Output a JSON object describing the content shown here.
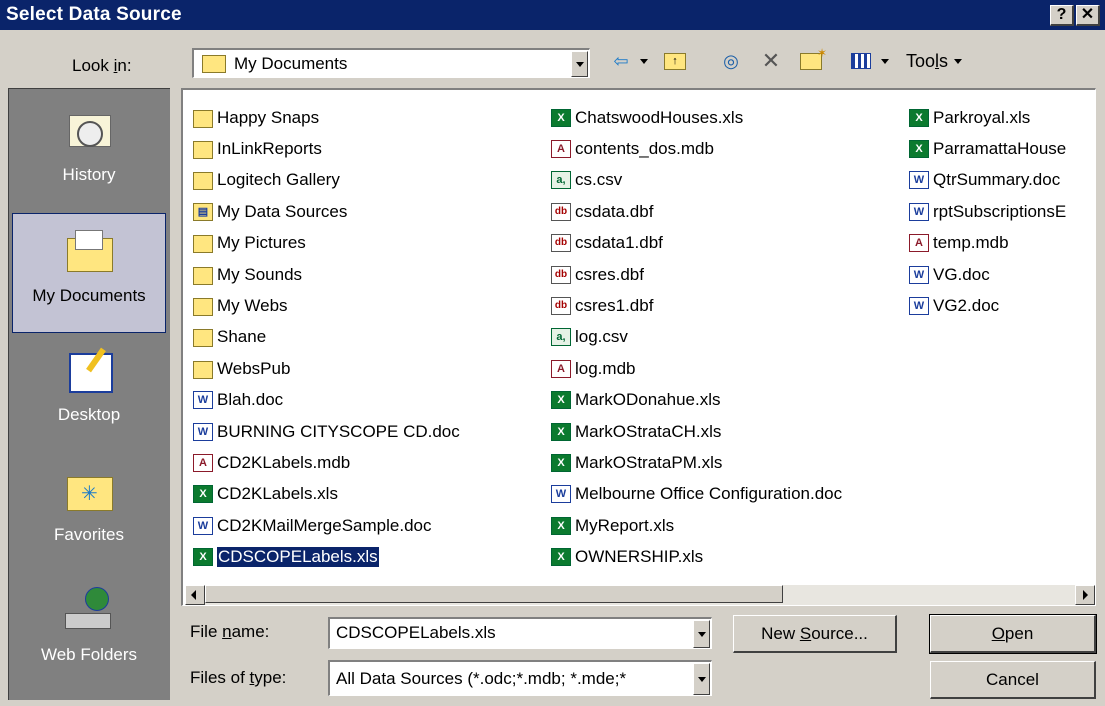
{
  "window": {
    "title": "Select Data Source",
    "help_button": "?",
    "close_button": "✕"
  },
  "toolbar": {
    "look_in_label": "Look in:",
    "look_in_value": "My Documents",
    "tools_label": "Tools",
    "icons": [
      "back-arrow-icon",
      "up-folder-icon",
      "search-web-icon",
      "delete-icon",
      "new-folder-icon",
      "views-icon"
    ]
  },
  "places": [
    {
      "label": "History",
      "icon": "history-icon",
      "selected": false
    },
    {
      "label": "My Documents",
      "icon": "my-documents-icon",
      "selected": true
    },
    {
      "label": "Desktop",
      "icon": "desktop-icon",
      "selected": false
    },
    {
      "label": "Favorites",
      "icon": "favorites-icon",
      "selected": false
    },
    {
      "label": "Web Folders",
      "icon": "web-folders-icon",
      "selected": false
    }
  ],
  "files": {
    "col1": [
      {
        "name": "Happy Snaps",
        "type": "folder"
      },
      {
        "name": "InLinkReports",
        "type": "folder"
      },
      {
        "name": "Logitech Gallery",
        "type": "folder"
      },
      {
        "name": "My Data Sources",
        "type": "ds"
      },
      {
        "name": "My Pictures",
        "type": "folder"
      },
      {
        "name": "My Sounds",
        "type": "folder"
      },
      {
        "name": "My Webs",
        "type": "folder"
      },
      {
        "name": "Shane",
        "type": "folder"
      },
      {
        "name": "WebsPub",
        "type": "folder"
      },
      {
        "name": "Blah.doc",
        "type": "doc"
      },
      {
        "name": "BURNING CITYSCOPE CD.doc",
        "type": "doc"
      },
      {
        "name": "CD2KLabels.mdb",
        "type": "mdb"
      },
      {
        "name": "CD2KLabels.xls",
        "type": "xls"
      },
      {
        "name": "CD2KMailMergeSample.doc",
        "type": "doc"
      },
      {
        "name": "CDSCOPELabels.xls",
        "type": "xls",
        "selected": true
      }
    ],
    "col2": [
      {
        "name": "ChatswoodHouses.xls",
        "type": "xls"
      },
      {
        "name": "contents_dos.mdb",
        "type": "mdb"
      },
      {
        "name": "cs.csv",
        "type": "csv"
      },
      {
        "name": "csdata.dbf",
        "type": "dbf"
      },
      {
        "name": "csdata1.dbf",
        "type": "dbf"
      },
      {
        "name": "csres.dbf",
        "type": "dbf"
      },
      {
        "name": "csres1.dbf",
        "type": "dbf"
      },
      {
        "name": "log.csv",
        "type": "csv"
      },
      {
        "name": "log.mdb",
        "type": "mdb"
      },
      {
        "name": "MarkODonahue.xls",
        "type": "xls"
      },
      {
        "name": "MarkOStrataCH.xls",
        "type": "xls"
      },
      {
        "name": "MarkOStrataPM.xls",
        "type": "xls"
      },
      {
        "name": "Melbourne Office Configuration.doc",
        "type": "doc"
      },
      {
        "name": "MyReport.xls",
        "type": "xls"
      },
      {
        "name": "OWNERSHIP.xls",
        "type": "xls"
      }
    ],
    "col3": [
      {
        "name": "Parkroyal.xls",
        "type": "xls"
      },
      {
        "name": "ParramattaHouse",
        "type": "xls"
      },
      {
        "name": "QtrSummary.doc",
        "type": "doc"
      },
      {
        "name": "rptSubscriptionsE",
        "type": "doc"
      },
      {
        "name": "temp.mdb",
        "type": "mdb"
      },
      {
        "name": "VG.doc",
        "type": "doc"
      },
      {
        "name": "VG2.doc",
        "type": "doc"
      }
    ]
  },
  "footer": {
    "file_name_label": "File name:",
    "file_name_value": "CDSCOPELabels.xls",
    "files_of_type_label": "Files of type:",
    "files_of_type_value": "All Data Sources (*.odc;*.mdb; *.mde;*",
    "new_source_label": "New Source...",
    "open_label": "Open",
    "cancel_label": "Cancel"
  },
  "colors": {
    "titlebar": "#0a246a",
    "dialog": "#d4d0c8",
    "places_bar": "#808080",
    "selection": "#0a246a"
  }
}
